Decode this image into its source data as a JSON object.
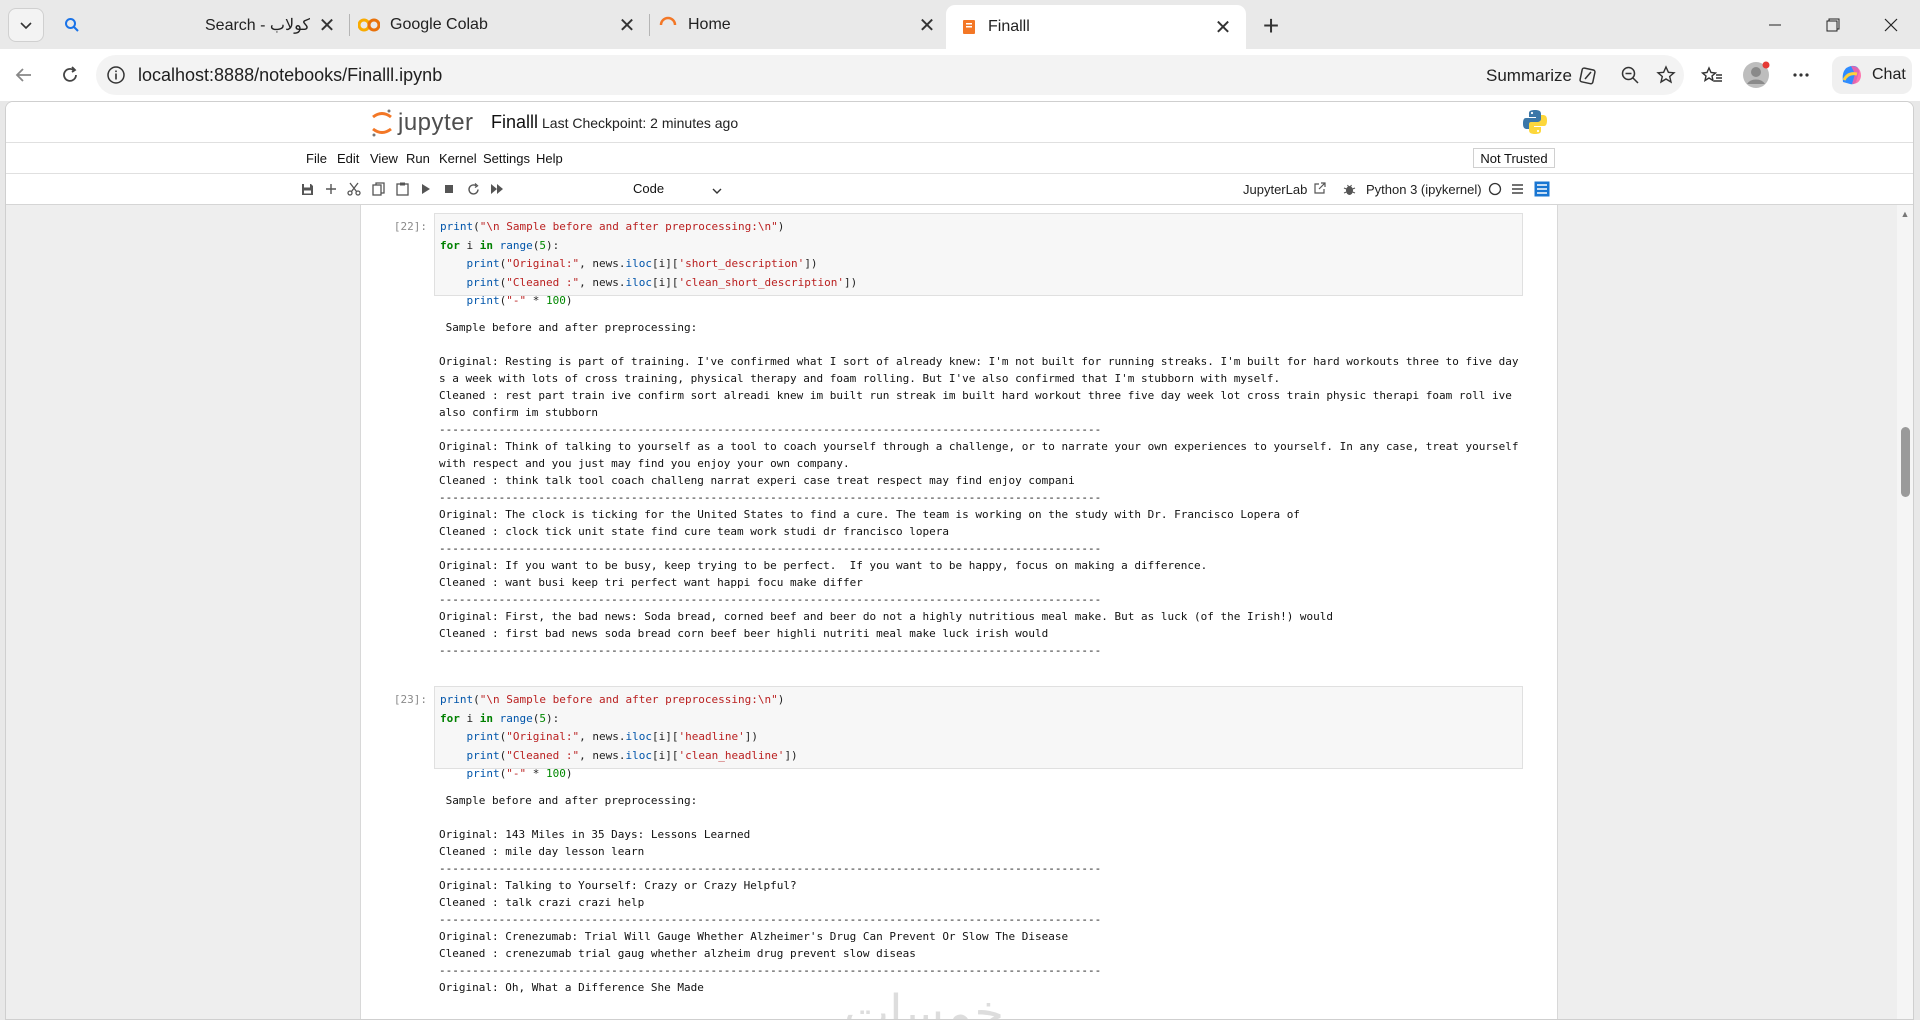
{
  "browser": {
    "tabs": [
      {
        "title": "Search - كولاب",
        "icon": "search-icon"
      },
      {
        "title": "Google Colab",
        "icon": "colab-icon"
      },
      {
        "title": "Home",
        "icon": "jupyter-spinner-icon"
      },
      {
        "title": "Finalll",
        "icon": "notebook-icon",
        "active": true
      }
    ],
    "url": "localhost:8888/notebooks/Finalll.ipynb",
    "summarize_label": "Summarize",
    "chat_label": "Chat"
  },
  "jupyter": {
    "logo_text": "jupyter",
    "notebook_name": "Finalll",
    "checkpoint": "Last Checkpoint: 2 minutes ago",
    "menu": [
      "File",
      "Edit",
      "View",
      "Run",
      "Kernel",
      "Settings",
      "Help"
    ],
    "trust_status": "Not Trusted",
    "cell_type": "Code",
    "jupyterlab_link": "JupyterLab",
    "kernel_name": "Python 3 (ipykernel)"
  },
  "cells": [
    {
      "prompt": "[22]:",
      "code": [
        "print(\"\\n Sample before and after preprocessing:\\n\")",
        "for i in range(5):",
        "    print(\"Original:\", news.iloc[i]['short_description'])",
        "    print(\"Cleaned :\", news.iloc[i]['clean_short_description'])",
        "    print(\"-\" * 100)"
      ],
      "output": [
        "",
        " Sample before and after preprocessing:",
        "",
        "Original: Resting is part of training. I've confirmed what I sort of already knew: I'm not built for running streaks. I'm built for hard workouts three to five days a week with lots of cross training, physical therapy and foam rolling. But I've also confirmed that I'm stubborn with myself.",
        "Cleaned : rest part train ive confirm sort alreadi knew im built run streak im built hard workout three five day week lot cross train physic therapi foam roll ive also confirm im stubborn",
        "----------------------------------------------------------------------------------------------------",
        "Original: Think of talking to yourself as a tool to coach yourself through a challenge, or to narrate your own experiences to yourself. In any case, treat yourself with respect and you just may find you enjoy your own company.",
        "Cleaned : think talk tool coach challeng narrat experi case treat respect may find enjoy compani",
        "----------------------------------------------------------------------------------------------------",
        "Original: The clock is ticking for the United States to find a cure. The team is working on the study with Dr. Francisco Lopera of",
        "Cleaned : clock tick unit state find cure team work studi dr francisco lopera",
        "----------------------------------------------------------------------------------------------------",
        "Original: If you want to be busy, keep trying to be perfect.  If you want to be happy, focus on making a difference.",
        "Cleaned : want busi keep tri perfect want happi focu make differ",
        "----------------------------------------------------------------------------------------------------",
        "Original: First, the bad news: Soda bread, corned beef and beer do not a highly nutritious meal make. But as luck (of the Irish!) would",
        "Cleaned : first bad news soda bread corn beef beer highli nutriti meal make luck irish would",
        "----------------------------------------------------------------------------------------------------"
      ]
    },
    {
      "prompt": "[23]:",
      "code": [
        "print(\"\\n Sample before and after preprocessing:\\n\")",
        "for i in range(5):",
        "    print(\"Original:\", news.iloc[i]['headline'])",
        "    print(\"Cleaned :\", news.iloc[i]['clean_headline'])",
        "    print(\"-\" * 100)"
      ],
      "output": [
        "",
        " Sample before and after preprocessing:",
        "",
        "Original: 143 Miles in 35 Days: Lessons Learned",
        "Cleaned : mile day lesson learn",
        "----------------------------------------------------------------------------------------------------",
        "Original: Talking to Yourself: Crazy or Crazy Helpful?",
        "Cleaned : talk crazi crazi help",
        "----------------------------------------------------------------------------------------------------",
        "Original: Crenezumab: Trial Will Gauge Whether Alzheimer's Drug Can Prevent Or Slow The Disease",
        "Cleaned : crenezumab trial gaug whether alzheim drug prevent slow diseas",
        "----------------------------------------------------------------------------------------------------",
        "Original: Oh, What a Difference She Made"
      ]
    }
  ],
  "watermark": "خمسات"
}
